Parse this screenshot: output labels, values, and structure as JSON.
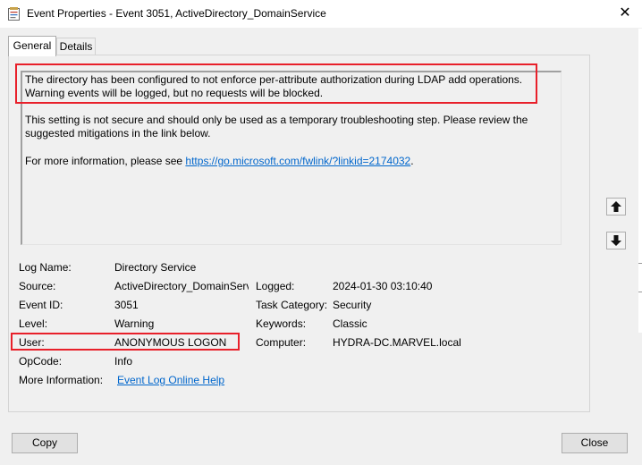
{
  "window": {
    "title": "Event Properties - Event 3051, ActiveDirectory_DomainService",
    "close_glyph": "✕"
  },
  "tabs": [
    {
      "label": "General",
      "active": true
    },
    {
      "label": "Details",
      "active": false
    }
  ],
  "description": {
    "para1_line1": "The directory has been configured to not enforce per-attribute authorization during LDAP add operations.",
    "para1_line2": "Warning events will be logged, but no requests will be blocked.",
    "para2_line1": "This setting is not secure and should only be used as a temporary troubleshooting step. Please review the",
    "para2_line2": "suggested mitigations in the link below.",
    "para3_prefix": "For more information, please see ",
    "para3_link": "https://go.microsoft.com/fwlink/?linkid=2174032",
    "para3_suffix": "."
  },
  "fields": {
    "log_name": {
      "label": "Log Name:",
      "value": "Directory Service"
    },
    "source": {
      "label": "Source:",
      "value": "ActiveDirectory_DomainServ"
    },
    "logged": {
      "label": "Logged:",
      "value": "2024-01-30 03:10:40"
    },
    "event_id": {
      "label": "Event ID:",
      "value": "3051"
    },
    "task_category": {
      "label": "Task Category:",
      "value": "Security"
    },
    "level": {
      "label": "Level:",
      "value": "Warning"
    },
    "keywords": {
      "label": "Keywords:",
      "value": "Classic"
    },
    "user": {
      "label": "User:",
      "value": "ANONYMOUS LOGON"
    },
    "computer": {
      "label": "Computer:",
      "value": "HYDRA-DC.MARVEL.local"
    },
    "opcode": {
      "label": "OpCode:",
      "value": "Info"
    },
    "more_info": {
      "label": "More Information:",
      "value": "Event Log Online Help"
    }
  },
  "buttons": {
    "copy": "Copy",
    "close": "Close"
  },
  "icons": {
    "app": "event-viewer-icon",
    "up": "arrow-up-icon",
    "down": "arrow-down-icon"
  },
  "colors": {
    "highlight_red": "#e8202a",
    "link_blue": "#0066cc"
  }
}
